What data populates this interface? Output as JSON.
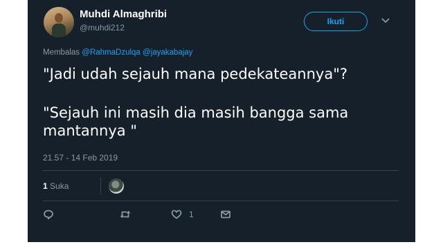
{
  "tweet": {
    "author_name": "Muhdi Almaghribi",
    "author_handle": "@muhdi212",
    "follow_label": "Ikuti",
    "reply_prefix": "Membalas",
    "reply_to": [
      "@RahmaDzulqa",
      "@jayakabajay"
    ],
    "paragraphs": [
      "\"Jadi udah sejauh mana pedekateannya\"?",
      "\"Sejauh ini masih dia masih bangga sama mantannya \""
    ],
    "timestamp": "21.57 - 14 Feb 2019",
    "likes_count": "1",
    "likes_label": "Suka",
    "actions": {
      "reply_icon": "reply-icon",
      "retweet_icon": "retweet-icon",
      "like_icon": "heart-icon",
      "like_count": "1",
      "dm_icon": "envelope-icon"
    }
  },
  "colors": {
    "background": "#15202b",
    "accent": "#1da1f2",
    "muted": "#8899a6",
    "divider": "#38444d"
  }
}
